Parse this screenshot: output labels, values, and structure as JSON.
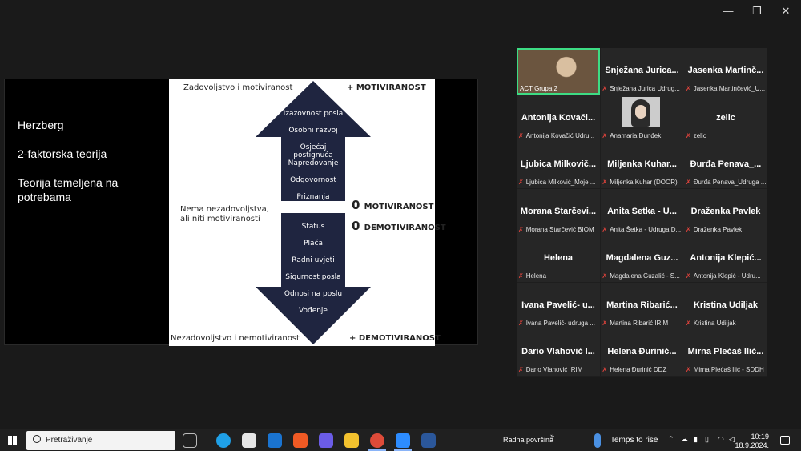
{
  "window": {
    "minimize": "—",
    "maximize": "❐",
    "close": "✕"
  },
  "slide": {
    "left": {
      "title": "Herzberg",
      "line2": "2-faktorska teorija",
      "line3": "Teorija temeljena na potrebama"
    },
    "top_left": "Zadovoljstvo i motiviranost",
    "top_right": "+ MOTIVIRANOST",
    "bottom_left": "Nezadovoljstvo i nemotiviranost",
    "bottom_right": "+ DEMOTIVIRANOST",
    "middle": "Nema nezadovoljstva, ali niti motiviranosti",
    "zero1_num": "0",
    "zero1_word": "MOTIVIRANOST",
    "zero2_num": "0",
    "zero2_word": "DEMOTIVIRANOST",
    "motivators": [
      "Izazovnost posla",
      "Osobni razvoj",
      "Osjećaj postignuća",
      "Napredovanje",
      "Odgovornost",
      "Priznanja"
    ],
    "hygiene": [
      "Status",
      "Plaća",
      "Radni uvjeti",
      "Sigurnost posla",
      "Odnosi na poslu",
      "Vođenje"
    ],
    "colors": {
      "arrow": "#1f2540"
    }
  },
  "participants": [
    {
      "name": "",
      "sub": "ACT Grupa 2",
      "video": true
    },
    {
      "name": "Snježana Jurica...",
      "sub": "Snježana Jurica Udrug..."
    },
    {
      "name": "Jasenka Martinč...",
      "sub": "Jasenka Martinčević_U..."
    },
    {
      "name": "Antonija Kovači...",
      "sub": "Antonija Kovačić Udru..."
    },
    {
      "name": "",
      "sub": "Anamaria Đunđek",
      "photo": true
    },
    {
      "name": "zelic",
      "sub": "zelic"
    },
    {
      "name": "Ljubica Milkovič...",
      "sub": "Ljubica Milković_Moje ..."
    },
    {
      "name": "Miljenka Kuhar...",
      "sub": "Miljenka Kuhar (DOOR)"
    },
    {
      "name": "Đurđa Penava_...",
      "sub": "Đurđa Penava_Udruga ..."
    },
    {
      "name": "Morana Starčevi...",
      "sub": "Morana Starčević BIOM"
    },
    {
      "name": "Anita Šetka - U...",
      "sub": "Anita Šetka - Udruga D..."
    },
    {
      "name": "Draženka Pavlek",
      "sub": "Draženka Pavlek"
    },
    {
      "name": "Helena",
      "sub": "Helena"
    },
    {
      "name": "Magdalena Guz...",
      "sub": "Magdalena Guzalić - S..."
    },
    {
      "name": "Antonija Klepić...",
      "sub": "Antonija Klepić - Udru..."
    },
    {
      "name": "Ivana Pavelić- u...",
      "sub": "Ivana Pavelić- udruga ..."
    },
    {
      "name": "Martina Ribarić...",
      "sub": "Martina Ribarić IRIM"
    },
    {
      "name": "Kristina Udiljak",
      "sub": "Kristina Udiljak"
    },
    {
      "name": "Dario Vlahović I...",
      "sub": "Dario Vlahović IRIM"
    },
    {
      "name": "Helena Đurinić...",
      "sub": "Helena Đurinić DDZ"
    },
    {
      "name": "Mirna Plećaš Ilić...",
      "sub": "Mirna Plećaš Ilić - SDDH"
    }
  ],
  "taskbar": {
    "search_placeholder": "Pretraživanje",
    "desktop_label": "Radna površina",
    "chevron": "»",
    "weather": "Temps to rise",
    "time": "10:19",
    "date": "18.9.2024."
  }
}
